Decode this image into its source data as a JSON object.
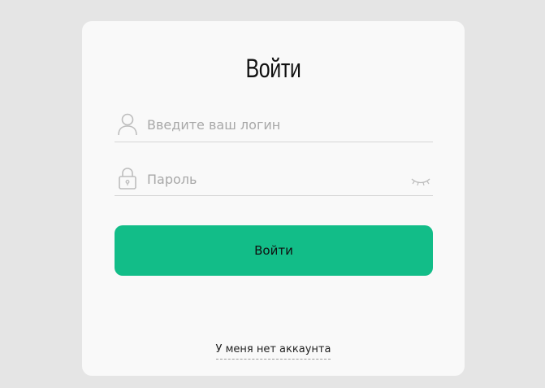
{
  "form": {
    "title": "Войти",
    "login": {
      "placeholder": "Введите ваш логин",
      "value": "",
      "icon": "user-icon"
    },
    "password": {
      "placeholder": "Пароль",
      "value": "",
      "icon": "lock-icon",
      "toggle_icon": "eye-closed-icon"
    },
    "submit_label": "Войти",
    "signup_link": "У меня нет аккаунта"
  },
  "colors": {
    "background": "#e5e5e5",
    "card": "#f9f9f9",
    "accent": "#12bd88",
    "placeholder": "#a8a8a8",
    "divider": "#d6d6d6"
  }
}
